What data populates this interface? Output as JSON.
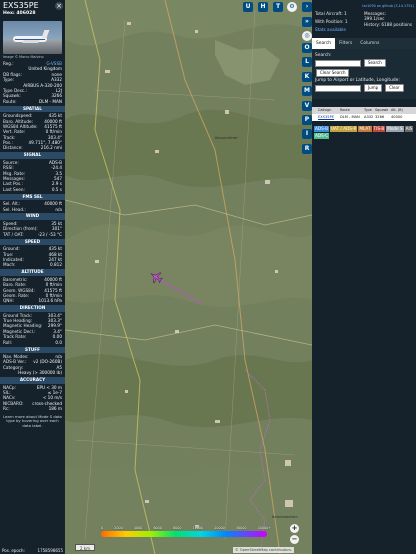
{
  "left_panel": {
    "callsign": "EXS35PE",
    "hex": "Hex: 406028",
    "photo_credit": "Image © Marco Malvino",
    "close_symbol": "×",
    "general": [
      {
        "k": "Reg.:",
        "v": "G-VSSB",
        "link": true
      },
      {
        "k": "",
        "v": "United Kingdom"
      },
      {
        "k": "DB flags:",
        "v": "none"
      },
      {
        "k": "Type:",
        "v": "A332"
      },
      {
        "k": "",
        "v": "AIRBUS A-330-200"
      },
      {
        "k": "Type Desc.:",
        "v": "L2J"
      },
      {
        "k": "Squawk:",
        "v": "3266"
      },
      {
        "k": "Route:",
        "v": "DLM - MAN"
      }
    ],
    "sections": [
      {
        "title": "SPATIAL",
        "rows": [
          {
            "k": "Groundspeed:",
            "v": "435 kt"
          },
          {
            "k": "Baro. Altitude:",
            "v": "40000 ft"
          },
          {
            "k": "WGS84 Altitude:",
            "v": "41575 ft"
          },
          {
            "k": "Vert. Rate:",
            "v": "0 ft/min"
          },
          {
            "k": "Track:",
            "v": "303.4°"
          },
          {
            "k": "Pos.:",
            "v": "49.711°, 7.480°"
          },
          {
            "k": "Distance:",
            "v": "216.2 nmi"
          }
        ]
      },
      {
        "title": "SIGNAL",
        "rows": [
          {
            "k": "Source:",
            "v": "ADS-B"
          },
          {
            "k": "RSSI:",
            "v": "-24.4"
          },
          {
            "k": "Msg. Rate:",
            "v": "3.5"
          },
          {
            "k": "Messages:",
            "v": "547"
          },
          {
            "k": "Last Pos.:",
            "v": "2.9 s"
          },
          {
            "k": "Last Seen:",
            "v": "0.5 s"
          }
        ]
      },
      {
        "title": "FMS SEL",
        "rows": [
          {
            "k": "Sel. Alt.:",
            "v": "40000 ft"
          },
          {
            "k": "Sel. Head.:",
            "v": "n/a"
          }
        ]
      },
      {
        "title": "WIND",
        "rows": [
          {
            "k": "Speed:",
            "v": "35 kt"
          },
          {
            "k": "Direction (from):",
            "v": "301°"
          },
          {
            "k": "TAT / OAT:",
            "v": "-23 / -53 °C"
          }
        ]
      },
      {
        "title": "SPEED",
        "rows": [
          {
            "k": "Ground:",
            "v": "435 kt"
          },
          {
            "k": "True:",
            "v": "468 kt"
          },
          {
            "k": "Indicated:",
            "v": "247 kt"
          },
          {
            "k": "Mach:",
            "v": "0.812"
          }
        ]
      },
      {
        "title": "ALTITUDE",
        "rows": [
          {
            "k": "Barometric:",
            "v": "40000 ft"
          },
          {
            "k": "Baro. Rate:",
            "v": "0 ft/min"
          },
          {
            "k": "Geom. WGS84:",
            "v": "41575 ft"
          },
          {
            "k": "Geom. Rate:",
            "v": "0 ft/min"
          },
          {
            "k": "QNH:",
            "v": "1013.6 hPa"
          }
        ]
      },
      {
        "title": "DIRECTION",
        "rows": [
          {
            "k": "Ground Track:",
            "v": "303.4°"
          },
          {
            "k": "True Heading:",
            "v": "303.3°"
          },
          {
            "k": "Magnetic Heading:",
            "v": "299.9°"
          },
          {
            "k": "Magnetic Decl.:",
            "v": "3.4°"
          },
          {
            "k": "Track Rate:",
            "v": "0.00"
          },
          {
            "k": "Roll:",
            "v": "0.0"
          }
        ]
      },
      {
        "title": "STUFF",
        "rows": [
          {
            "k": "Nav. Modes:",
            "v": "n/a"
          },
          {
            "k": "ADS-B Ver.:",
            "v": "v2 (DO-260B)"
          },
          {
            "k": "Category:",
            "v": "A5"
          },
          {
            "k": "",
            "v": "Heavy (> 300000 lb)"
          }
        ]
      },
      {
        "title": "ACCURACY",
        "rows": [
          {
            "k": "NACp:",
            "v": "EPU < 30 m"
          },
          {
            "k": "SIL:",
            "v": "≤ 1e-7"
          },
          {
            "k": "NACv:",
            "v": "< 10 m/s"
          },
          {
            "k": "NICBARO:",
            "v": "cross-checked"
          },
          {
            "k": "Rc:",
            "v": "186 m"
          }
        ]
      }
    ],
    "note": "Learn more about Mode S data type by hovering over each data label.",
    "pos_epoch_label": "Pos. epoch:",
    "pos_epoch_value": "1758598655"
  },
  "map": {
    "top_buttons": [
      "U",
      "H",
      "T"
    ],
    "side_buttons": [
      "O",
      "L",
      "K",
      "M",
      "V",
      "P",
      "I",
      "R"
    ],
    "zoom_in": "+",
    "zoom_out": "−",
    "scale": "2 km",
    "attribution": "© OpenStreetMap contributors.",
    "places": [
      "Nossentiner",
      "Kaiserslautern"
    ],
    "altitude_scale": [
      "0",
      "2000",
      "4000",
      "6000",
      "8000",
      "10000",
      "20000",
      "30000",
      "40000+"
    ],
    "colors": {
      "track": "#c050d0",
      "button": "#004c80"
    }
  },
  "right_panel": {
    "github": "tar1090 on github (3.14.1751)",
    "stats": {
      "total_aircraft_label": "Total Aircraft:",
      "total_aircraft": "1",
      "with_position_label": "With Position:",
      "with_position": "1",
      "messages_label": "Messages:",
      "messages": "399.1/sec",
      "history_label": "History:",
      "history": "6188 positions",
      "stats_link": "Stats available"
    },
    "tabs": [
      "Search",
      "Filters",
      "Columns"
    ],
    "search_label": "Search:",
    "search_button": "Search",
    "clear_search_button": "Clear Search",
    "jump_label": "Jump to Airport or Latitude, Longitude:",
    "jump_button": "Jump",
    "clear_button": "Clear",
    "table_headers": [
      "",
      "Callsign",
      "Route",
      "Type",
      "Squawk",
      "Alt. (ft)"
    ],
    "table_rows": [
      [
        "",
        "EXS35PE",
        "DLM - MAN",
        "A332",
        "3266",
        "40000"
      ]
    ],
    "legend": [
      "ADS-B",
      "UAT / ADS-R",
      "MLAT",
      "TIS-B",
      "Mode S",
      "AIS",
      "ADS-C"
    ],
    "legend_colors": [
      "#3a8fd8",
      "#c2a03c",
      "#c27a3c",
      "#c2483c",
      "#9aa3ad",
      "#6a6a6a",
      "#4fbf8f"
    ]
  }
}
